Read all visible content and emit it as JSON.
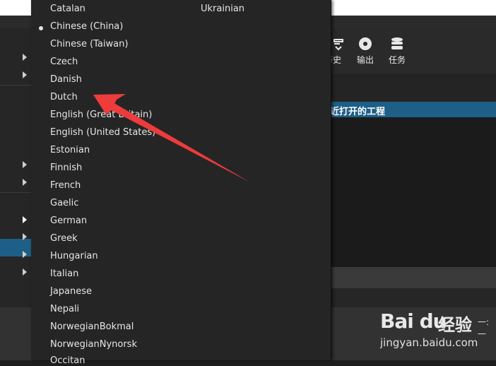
{
  "dropdown": {
    "languages_col1": [
      "Catalan",
      "Chinese (China)",
      "Chinese (Taiwan)",
      "Czech",
      "Danish",
      "Dutch",
      "English (Great Britain)",
      "English (United States)",
      "Estonian",
      "Finnish",
      "French",
      "Gaelic",
      "German",
      "Greek",
      "Hungarian",
      "Italian",
      "Japanese",
      "Nepali",
      "NorwegianBokmal",
      "NorwegianNynorsk",
      "Occitan"
    ],
    "languages_col2": [
      "Ukrainian"
    ],
    "selected": "Chinese (China)"
  },
  "toolbar": {
    "history_label": "历史",
    "export_label": "输出",
    "jobs_label": "任务"
  },
  "recent": {
    "title": "最近打开的工程"
  },
  "bottom": {
    "right_text": "一:一"
  },
  "watermark": {
    "logo": "Bai du",
    "brand": "经验",
    "url": "jingyan.baidu.com"
  },
  "colors": {
    "accent": "#1d5f86",
    "arrow": "#ee3b3b",
    "menu_bg": "#252525"
  }
}
